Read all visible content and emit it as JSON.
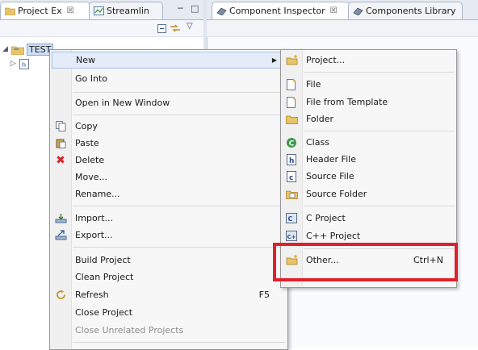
{
  "tabs_left": [
    {
      "label": "Project Ex",
      "close": "☒"
    },
    {
      "label": "Streamlin"
    }
  ],
  "tabs_right": [
    {
      "label": "Component Inspector",
      "close": "☒"
    },
    {
      "label": "Components Library"
    }
  ],
  "tree": {
    "project_label": "TEST"
  },
  "context_menu": {
    "items": {
      "new": "New",
      "go_into": "Go Into",
      "open_new_window": "Open in New Window",
      "copy": "Copy",
      "paste": "Paste",
      "delete": "Delete",
      "move": "Move...",
      "rename": "Rename...",
      "import": "Import...",
      "export": "Export...",
      "build_project": "Build Project",
      "clean_project": "Clean Project",
      "refresh": "Refresh",
      "refresh_shortcut": "F5",
      "close_project": "Close Project",
      "close_unrelated": "Close Unrelated Projects"
    }
  },
  "submenu_new": {
    "items": {
      "project": "Project...",
      "file": "File",
      "file_from_template": "File from Template",
      "folder": "Folder",
      "class": "Class",
      "header_file": "Header File",
      "source_file": "Source File",
      "source_folder": "Source Folder",
      "c_project": "C Project",
      "cpp_project": "C++ Project",
      "other": "Other...",
      "other_shortcut": "Ctrl+N"
    }
  },
  "colors": {
    "highlight_box": "#e0202a",
    "menu_hover": "#e4ecf7"
  }
}
